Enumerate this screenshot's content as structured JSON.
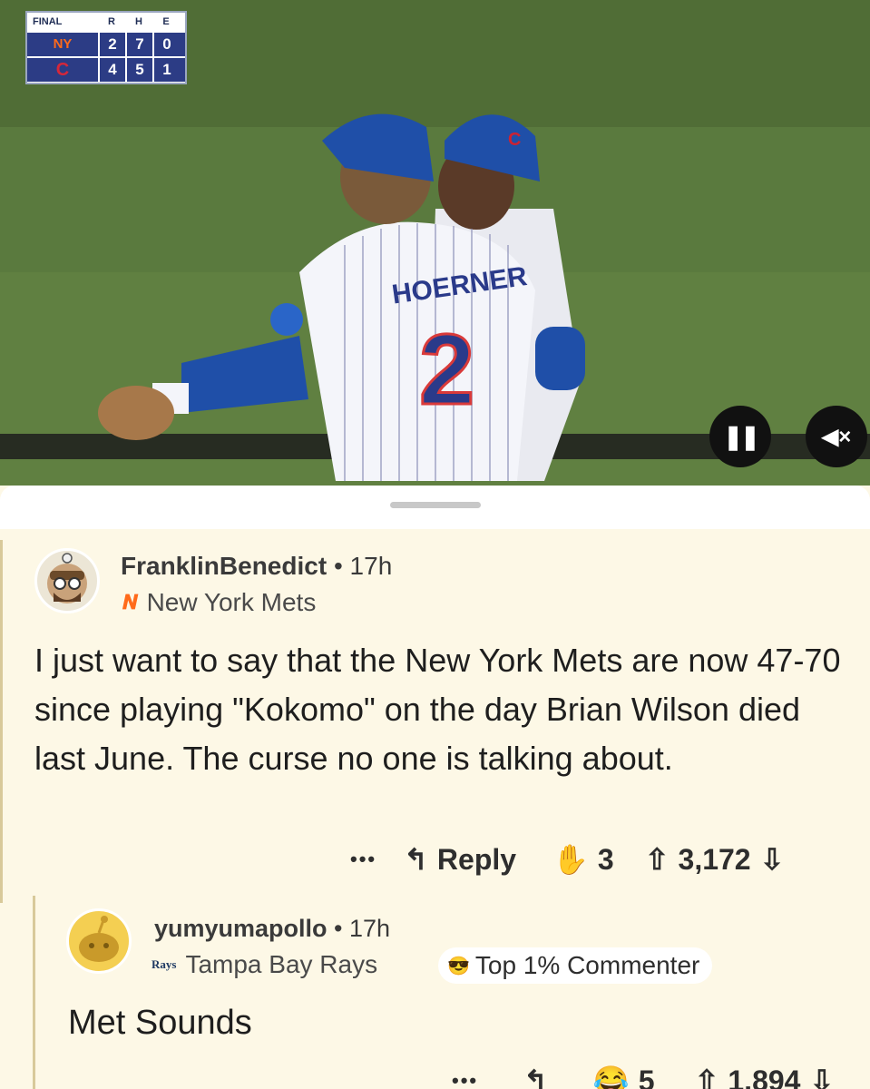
{
  "scoreboard": {
    "status": "FINAL",
    "headers": [
      "R",
      "H",
      "E"
    ],
    "rows": [
      {
        "team_icon": "mets-logo",
        "team_glyph": "NY",
        "r": "2",
        "h": "7",
        "e": "0"
      },
      {
        "team_icon": "cubs-logo",
        "team_glyph": "C",
        "r": "4",
        "h": "5",
        "e": "1"
      }
    ]
  },
  "video": {
    "jersey_name": "HOERNER",
    "jersey_number": "2",
    "pause_icon": "pause-icon",
    "mute_icon": "mute-icon",
    "pause_glyph": "❚❚",
    "mute_glyph": "◀×"
  },
  "comments": [
    {
      "username": "FranklinBenedict",
      "separator": "•",
      "time": "17h",
      "flair_glyph": "𝑵",
      "flair": "New York Mets",
      "body": "I just want to say that the New York Mets are now 47-70 since playing \"Kokomo\" on the day Brian Wilson died last June. The curse no one is talking about.",
      "more": "•••",
      "reply_label": "Reply",
      "award_count": "3",
      "score": "3,172"
    },
    {
      "username": "yumyumapollo",
      "separator": "•",
      "time": "17h",
      "flair_glyph": "Rays",
      "flair": "Tampa Bay Rays",
      "badge": "Top 1% Commenter",
      "body": "Met Sounds",
      "more": "•••",
      "award_count": "5",
      "score": "1,894"
    }
  ],
  "colors": {
    "sheet_bg": "#fdf8e6",
    "mets_orange": "#ff6a1a",
    "scorebug_blue": "#2c3c85",
    "cubs_blue": "#1f4fa8"
  }
}
